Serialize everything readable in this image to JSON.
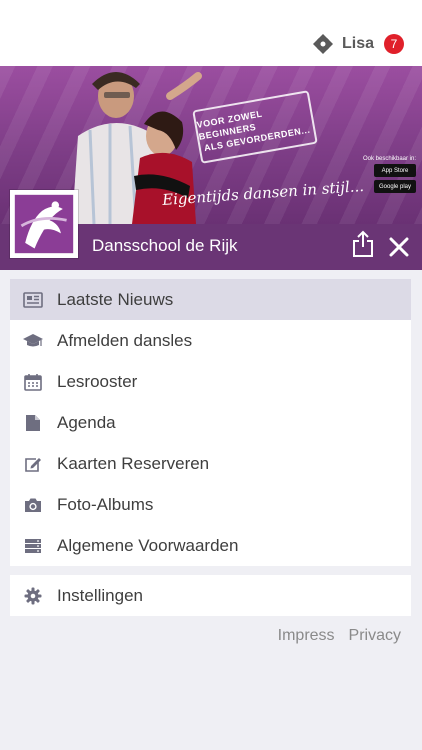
{
  "topbar": {
    "user_name": "Lisa",
    "notification_count": "7"
  },
  "banner": {
    "stamp_line1": "VOOR ZOWEL BEGINNERS",
    "stamp_line2": "ALS GEVORDERDEN...",
    "slogan": "Eigentijds dansen in stijl...",
    "store_caption": "Ook beschikbaar in:",
    "app_store": "App Store",
    "google_play": "Google play"
  },
  "header": {
    "title": "Dansschool de Rijk"
  },
  "menu": {
    "items": [
      {
        "label": "Laatste Nieuws",
        "icon": "newspaper-icon",
        "active": true
      },
      {
        "label": "Afmelden dansles",
        "icon": "graduation-cap-icon"
      },
      {
        "label": "Lesrooster",
        "icon": "calendar-icon"
      },
      {
        "label": "Agenda",
        "icon": "document-icon"
      },
      {
        "label": "Kaarten Reserveren",
        "icon": "edit-icon"
      },
      {
        "label": "Foto-Albums",
        "icon": "camera-icon"
      },
      {
        "label": "Algemene Voorwaarden",
        "icon": "server-icon"
      }
    ],
    "settings": {
      "label": "Instellingen",
      "icon": "gear-icon"
    }
  },
  "footer": {
    "impress": "Impress",
    "privacy": "Privacy"
  },
  "colors": {
    "brand_purple": "#6a3575",
    "icon_gray": "#6e6e80",
    "badge_red": "#e0202a"
  }
}
